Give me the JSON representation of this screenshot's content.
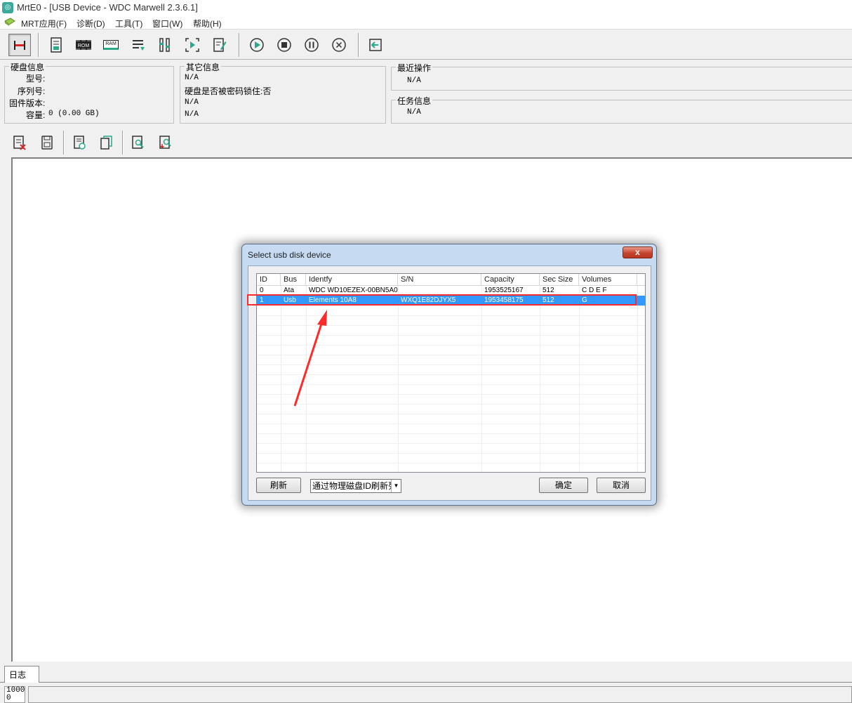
{
  "window": {
    "title": "MrtE0 - [USB Device - WDC Marwell 2.3.6.1]"
  },
  "menu": {
    "items": [
      "MRT应用(F)",
      "诊断(D)",
      "工具(T)",
      "窗口(W)",
      "帮助(H)"
    ]
  },
  "toolbar": {
    "icons": [
      "hdd-connect-icon",
      "pcb-icon",
      "rom-icon",
      "ram-icon",
      "list-icon",
      "tools-icon",
      "scan-icon",
      "edit-icon",
      "play-icon",
      "stop-icon",
      "pause-icon",
      "cancel-icon",
      "exit-icon"
    ],
    "rom_label": "ROM",
    "ram_label": "RAM"
  },
  "disk_info": {
    "title": "硬盘信息",
    "model_label": "型号:",
    "serial_label": "序列号:",
    "firmware_label": "固件版本:",
    "capacity_label": "容量:",
    "capacity_value": "0 (0.00 GB)"
  },
  "other_info": {
    "title": "其它信息",
    "line1": "N/A",
    "line2": "硬盘是否被密码锁住:否",
    "line3": "N/A",
    "line4": "N/A"
  },
  "recent_ops": {
    "title": "最近操作",
    "value": "N/A"
  },
  "task_info": {
    "title": "任务信息",
    "value": "N/A"
  },
  "toolbar2": {
    "icons": [
      "clear-log-icon",
      "save-icon",
      "report-icon",
      "copy-icon",
      "find-icon",
      "find-next-icon"
    ]
  },
  "dialog": {
    "title": "Select usb disk device",
    "close_label": "x",
    "columns": [
      "ID",
      "Bus",
      "Identfy",
      "S/N",
      "Capacity",
      "Sec Size",
      "Volumes"
    ],
    "rows": [
      {
        "id": "0",
        "bus": "Ata",
        "identify": "WDC WD10EZEX-00BN5A0",
        "sn": "",
        "capacity": "1953525167",
        "sec_size": "512",
        "volumes": "C D E F"
      },
      {
        "id": "1",
        "bus": "Usb",
        "identify": "Elements 10A8",
        "sn": "WXQ1E82DJYX5",
        "capacity": "1953458175",
        "sec_size": "512",
        "volumes": "G"
      }
    ],
    "selected_row": 1,
    "refresh_button": "刷新",
    "mode_select": "通过物理磁盘ID刷新列表",
    "ok_button": "确定",
    "cancel_button": "取消"
  },
  "annotation": {
    "highlight_color": "#ff2a2a"
  },
  "log": {
    "tab_label": "日志",
    "counter_top": "1000",
    "counter_bottom": "0"
  }
}
